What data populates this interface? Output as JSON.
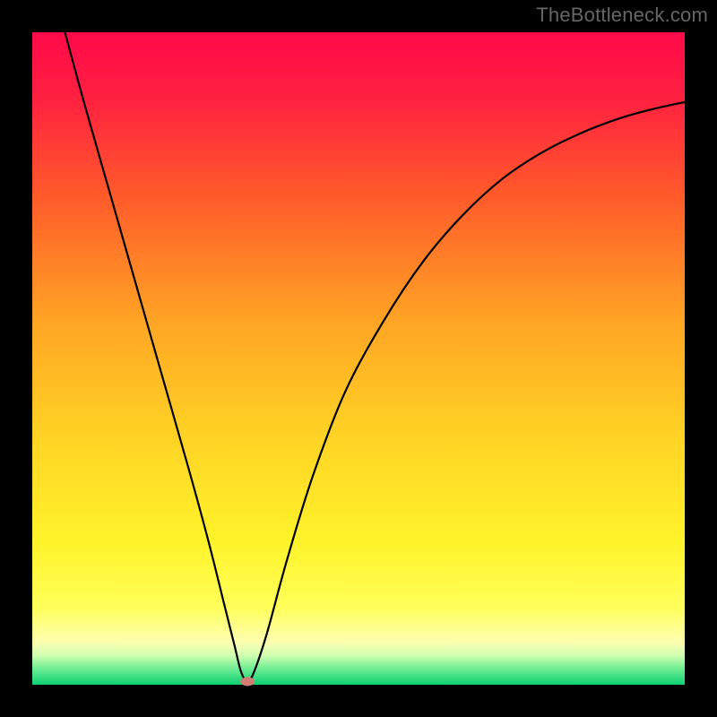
{
  "watermark": "TheBottleneck.com",
  "chart_data": {
    "type": "line",
    "title": "",
    "xlabel": "",
    "ylabel": "",
    "xlim": [
      0,
      100
    ],
    "ylim": [
      0,
      100
    ],
    "background": {
      "type": "vertical-gradient",
      "stops": [
        {
          "pos": 0.0,
          "color": "#ff0a4a"
        },
        {
          "pos": 0.1,
          "color": "#ff2040"
        },
        {
          "pos": 0.25,
          "color": "#ff5a2a"
        },
        {
          "pos": 0.45,
          "color": "#ffa724"
        },
        {
          "pos": 0.62,
          "color": "#ffd324"
        },
        {
          "pos": 0.78,
          "color": "#fff32a"
        },
        {
          "pos": 0.88,
          "color": "#ffff58"
        },
        {
          "pos": 0.935,
          "color": "#fcffb0"
        },
        {
          "pos": 0.955,
          "color": "#d0ffb0"
        },
        {
          "pos": 0.975,
          "color": "#70ee94"
        },
        {
          "pos": 1.0,
          "color": "#0cd070"
        }
      ]
    },
    "frame_color": "#000000",
    "frame_width_pct": 4.5,
    "series": [
      {
        "name": "bottleneck-curve",
        "color": "#000000",
        "x": [
          5,
          8,
          12,
          16,
          20,
          24,
          27,
          29.5,
          31,
          32,
          33,
          34,
          36,
          39,
          43,
          48,
          54,
          60,
          66,
          72,
          78,
          84,
          90,
          95,
          100
        ],
        "y": [
          100,
          89,
          75,
          61,
          47,
          33,
          22,
          12,
          6,
          2,
          0.5,
          2,
          8,
          19,
          32,
          45,
          56,
          65,
          72,
          77.5,
          81.5,
          84.5,
          86.8,
          88.2,
          89.3
        ]
      }
    ],
    "marker": {
      "x": 33,
      "y": 0.5,
      "color": "#d47b74",
      "rx": 8,
      "ry": 5
    }
  }
}
